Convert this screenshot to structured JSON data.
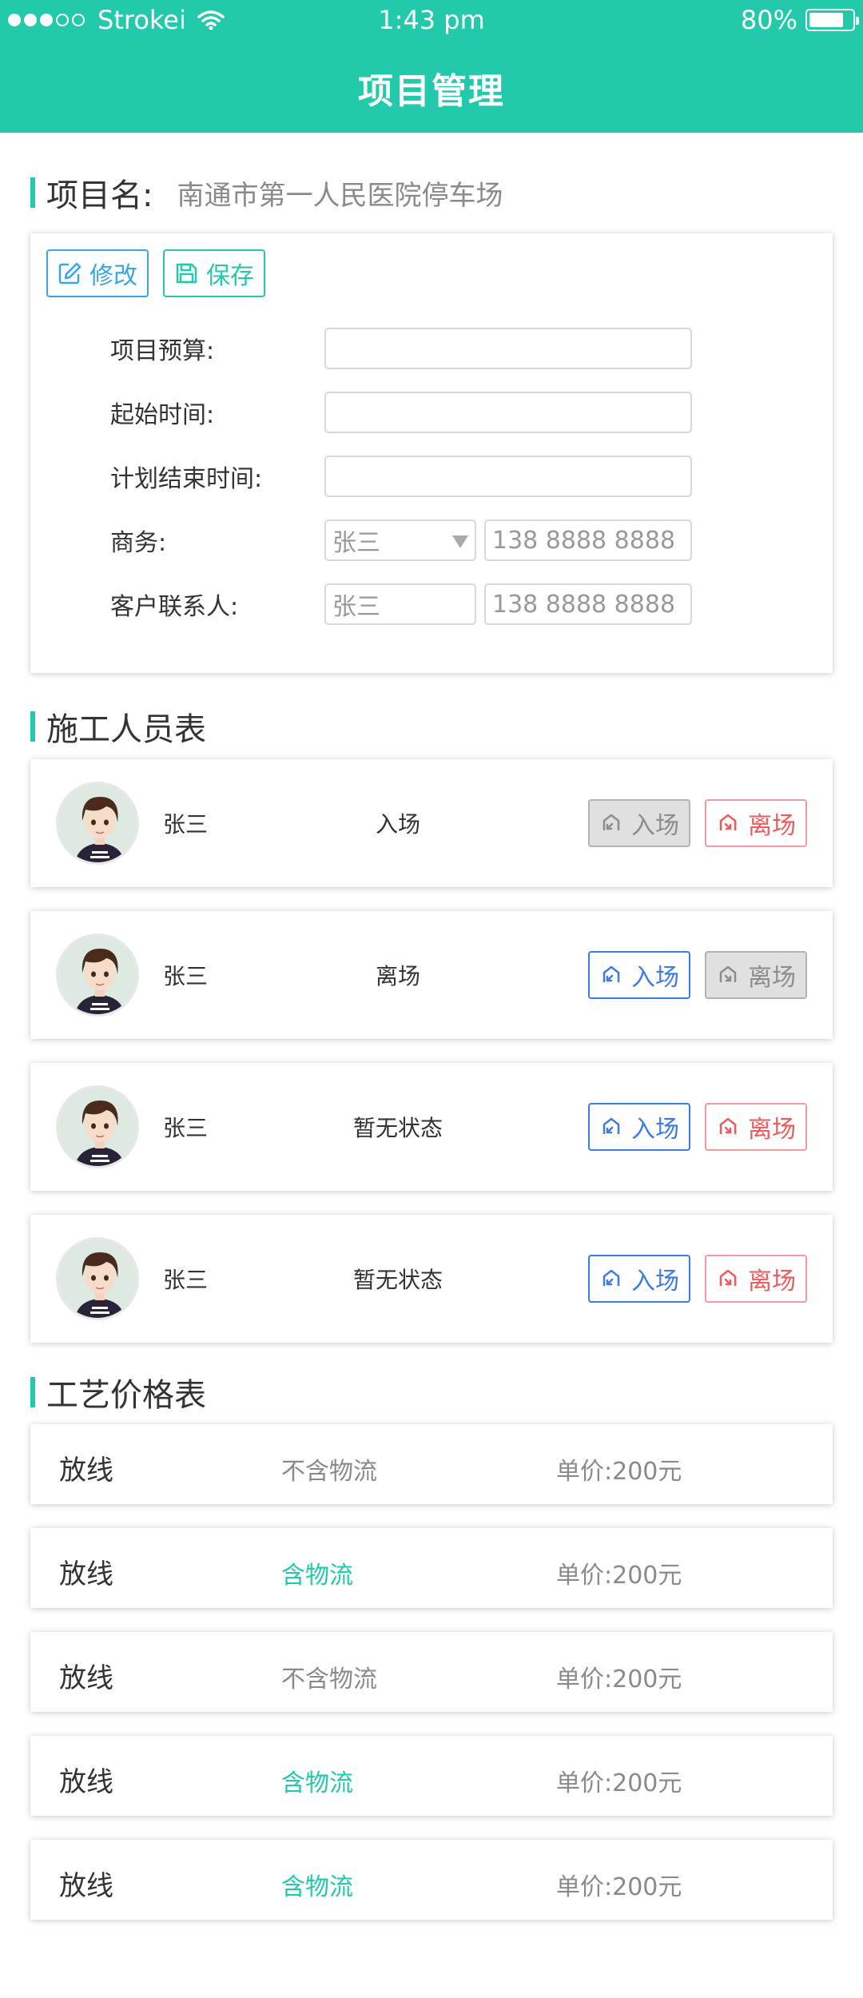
{
  "status_bar": {
    "carrier": "Strokei",
    "time": "1:43 pm",
    "battery": "80%",
    "battery_level": 0.8,
    "signal_filled": 3,
    "signal_total": 5
  },
  "header": {
    "title": "项目管理"
  },
  "project": {
    "name_label": "项目名:",
    "name_value": "南通市第一人民医院停车场"
  },
  "toolbar": {
    "edit_label": "修改",
    "save_label": "保存"
  },
  "form": {
    "budget_label": "项目预算:",
    "budget_value": "",
    "start_label": "起始时间:",
    "start_value": "",
    "end_label": "计划结束时间:",
    "end_value": "",
    "business_label": "商务:",
    "business_name_placeholder": "张三",
    "business_phone_placeholder": "138 8888 8888",
    "contact_label": "客户联系人:",
    "contact_name_placeholder": "张三",
    "contact_phone_placeholder": "138 8888 8888"
  },
  "workers": {
    "title": "施工人员表",
    "rows": [
      {
        "name": "张三",
        "status": "入场",
        "in_label": "入场",
        "out_label": "离场",
        "in_style": "gray",
        "out_style": "red"
      },
      {
        "name": "张三",
        "status": "离场",
        "in_label": "入场",
        "out_label": "离场",
        "in_style": "blue",
        "out_style": "gray"
      },
      {
        "name": "张三",
        "status": "暂无状态",
        "in_label": "入场",
        "out_label": "离场",
        "in_style": "blue",
        "out_style": "red"
      },
      {
        "name": "张三",
        "status": "暂无状态",
        "in_label": "入场",
        "out_label": "离场",
        "in_style": "blue",
        "out_style": "red"
      }
    ]
  },
  "prices": {
    "title": "工艺价格表",
    "rows": [
      {
        "name": "放线",
        "logistics": "不含物流",
        "included": false,
        "unit_price": "单价:200元"
      },
      {
        "name": "放线",
        "logistics": "含物流",
        "included": true,
        "unit_price": "单价:200元"
      },
      {
        "name": "放线",
        "logistics": "不含物流",
        "included": false,
        "unit_price": "单价:200元"
      },
      {
        "name": "放线",
        "logistics": "含物流",
        "included": true,
        "unit_price": "单价:200元"
      },
      {
        "name": "放线",
        "logistics": "含物流",
        "included": true,
        "unit_price": "单价:200元"
      }
    ]
  },
  "colors": {
    "accent": "#22c9aa",
    "edit_blue": "#3aa6e8",
    "enter_blue": "#3d7be8",
    "leave_red": "#f05a5a",
    "disabled_gray": "#e0e0e0",
    "logistics_included": "#22c9aa",
    "logistics_excluded": "#8a8a8a"
  }
}
